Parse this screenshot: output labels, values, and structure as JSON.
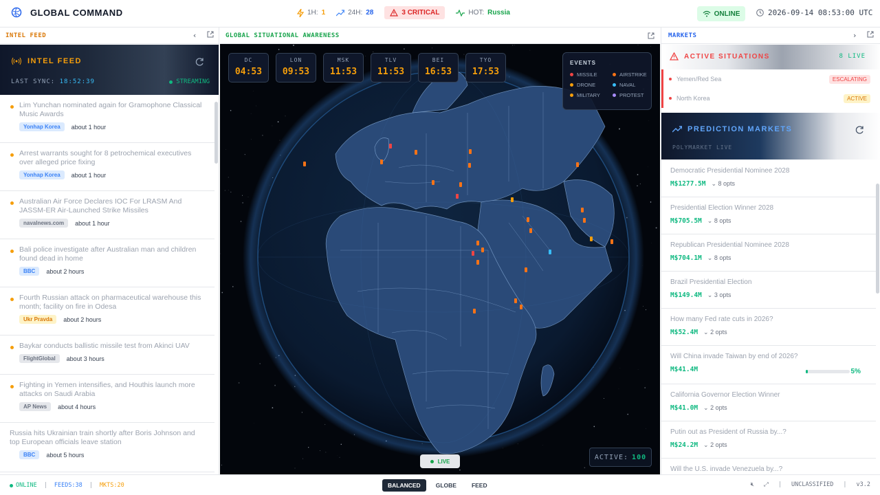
{
  "app": {
    "title": "GLOBAL COMMAND"
  },
  "stats": {
    "h1_label": "1H:",
    "h1_value": "1",
    "h24_label": "24H:",
    "h24_value": "28",
    "critical": "3 CRITICAL",
    "hot_label": "HOT:",
    "hot_value": "Russia"
  },
  "status": {
    "online": "ONLINE",
    "datetime": "2026-09-14 08:53:00 UTC"
  },
  "left_panel": {
    "header": "INTEL FEED",
    "banner_title": "INTEL FEED",
    "last_sync_label": "LAST SYNC:",
    "last_sync_time": "18:52:39",
    "stream_status": "STREAMING",
    "items": [
      {
        "headline": "Lim Yunchan nominated again for Gramophone Classical Music Awards",
        "source": "Yonhap Korea",
        "source_style": "blue",
        "time": "about 1 hour"
      },
      {
        "headline": "Arrest warrants sought for 8 petrochemical executives over alleged price fixing",
        "source": "Yonhap Korea",
        "source_style": "blue",
        "time": "about 1 hour"
      },
      {
        "headline": "Australian Air Force Declares IOC For LRASM And JASSM-ER Air-Launched Strike Missiles",
        "source": "navalnews.com",
        "source_style": "gray",
        "time": "about 1 hour"
      },
      {
        "headline": "Bali police investigate after Australian man and children found dead in home",
        "source": "BBC",
        "source_style": "blue",
        "time": "about 2 hours"
      },
      {
        "headline": "Fourth Russian attack on pharmaceutical warehouse this month; facility on fire in Odesa",
        "source": "Ukr Pravda",
        "source_style": "yellow",
        "time": "about 2 hours"
      },
      {
        "headline": "Baykar conducts ballistic missile test from Akinci UAV",
        "source": "FlightGlobal",
        "source_style": "gray",
        "time": "about 3 hours"
      },
      {
        "headline": "Fighting in Yemen intensifies, and Houthis launch more attacks on Saudi Arabia",
        "source": "AP News",
        "source_style": "gray",
        "time": "about 4 hours"
      },
      {
        "headline": "Russia hits Ukrainian train shortly after Boris Johnson and top European officials leave station",
        "source": "BBC",
        "source_style": "blue",
        "time": "about 5 hours"
      }
    ]
  },
  "center_panel": {
    "header": "GLOBAL SITUATIONAL AWARENESS",
    "clocks": [
      {
        "city": "DC",
        "time": "04:53"
      },
      {
        "city": "LON",
        "time": "09:53"
      },
      {
        "city": "MSK",
        "time": "11:53"
      },
      {
        "city": "TLV",
        "time": "11:53"
      },
      {
        "city": "BEI",
        "time": "16:53"
      },
      {
        "city": "TYO",
        "time": "17:53"
      }
    ],
    "legend": {
      "title": "EVENTS",
      "items": [
        {
          "label": "MISSILE",
          "color": "#ef4444"
        },
        {
          "label": "AIRSTRIKE",
          "color": "#f97316"
        },
        {
          "label": "DRONE",
          "color": "#f59e0b"
        },
        {
          "label": "NAVAL",
          "color": "#38bdf8"
        },
        {
          "label": "MILITARY",
          "color": "#f59e0b"
        },
        {
          "label": "PROTEST",
          "color": "#a78bfa"
        }
      ]
    },
    "live_label": "LIVE",
    "active_label": "ACTIVE:",
    "active_value": "100"
  },
  "right_panel": {
    "header": "MARKETS",
    "situations_title": "ACTIVE SITUATIONS",
    "situations_live": "8 LIVE",
    "situations": [
      {
        "name": "Yemen/Red Sea",
        "badge": "ESCALATING"
      },
      {
        "name": "North Korea",
        "badge": "ACTIVE"
      }
    ],
    "prediction_title": "PREDICTION MARKETS",
    "prediction_sub": "POLYMARKET LIVE",
    "markets": [
      {
        "question": "Democratic Presidential Nominee 2028",
        "volume": "M$1277.5M",
        "opts": "8 opts"
      },
      {
        "question": "Presidential Election Winner 2028",
        "volume": "M$705.5M",
        "opts": "8 opts"
      },
      {
        "question": "Republican Presidential Nominee 2028",
        "volume": "M$704.1M",
        "opts": "8 opts"
      },
      {
        "question": "Brazil Presidential Election",
        "volume": "M$149.4M",
        "opts": "3 opts"
      },
      {
        "question": "How many Fed rate cuts in 2026?",
        "volume": "M$52.4M",
        "opts": "2 opts"
      },
      {
        "question": "Will China invade Taiwan by end of 2026?",
        "volume": "M$41.4M",
        "opts": "",
        "percent": "5%",
        "percent_value": 0.05
      },
      {
        "question": "California Governor Election Winner",
        "volume": "M$41.0M",
        "opts": "2 opts"
      },
      {
        "question": "Putin out as President of Russia by...?",
        "volume": "M$24.2M",
        "opts": "2 opts"
      },
      {
        "question": "Will the U.S. invade Venezuela by...?",
        "volume": "",
        "opts": ""
      }
    ]
  },
  "bottom": {
    "online": "ONLINE",
    "feeds": "FEEDS:38",
    "mkts": "MKTS:20",
    "modes": [
      "BALANCED",
      "GLOBE",
      "FEED"
    ],
    "classification": "UNCLASSIFIED",
    "version": "v3.2"
  }
}
